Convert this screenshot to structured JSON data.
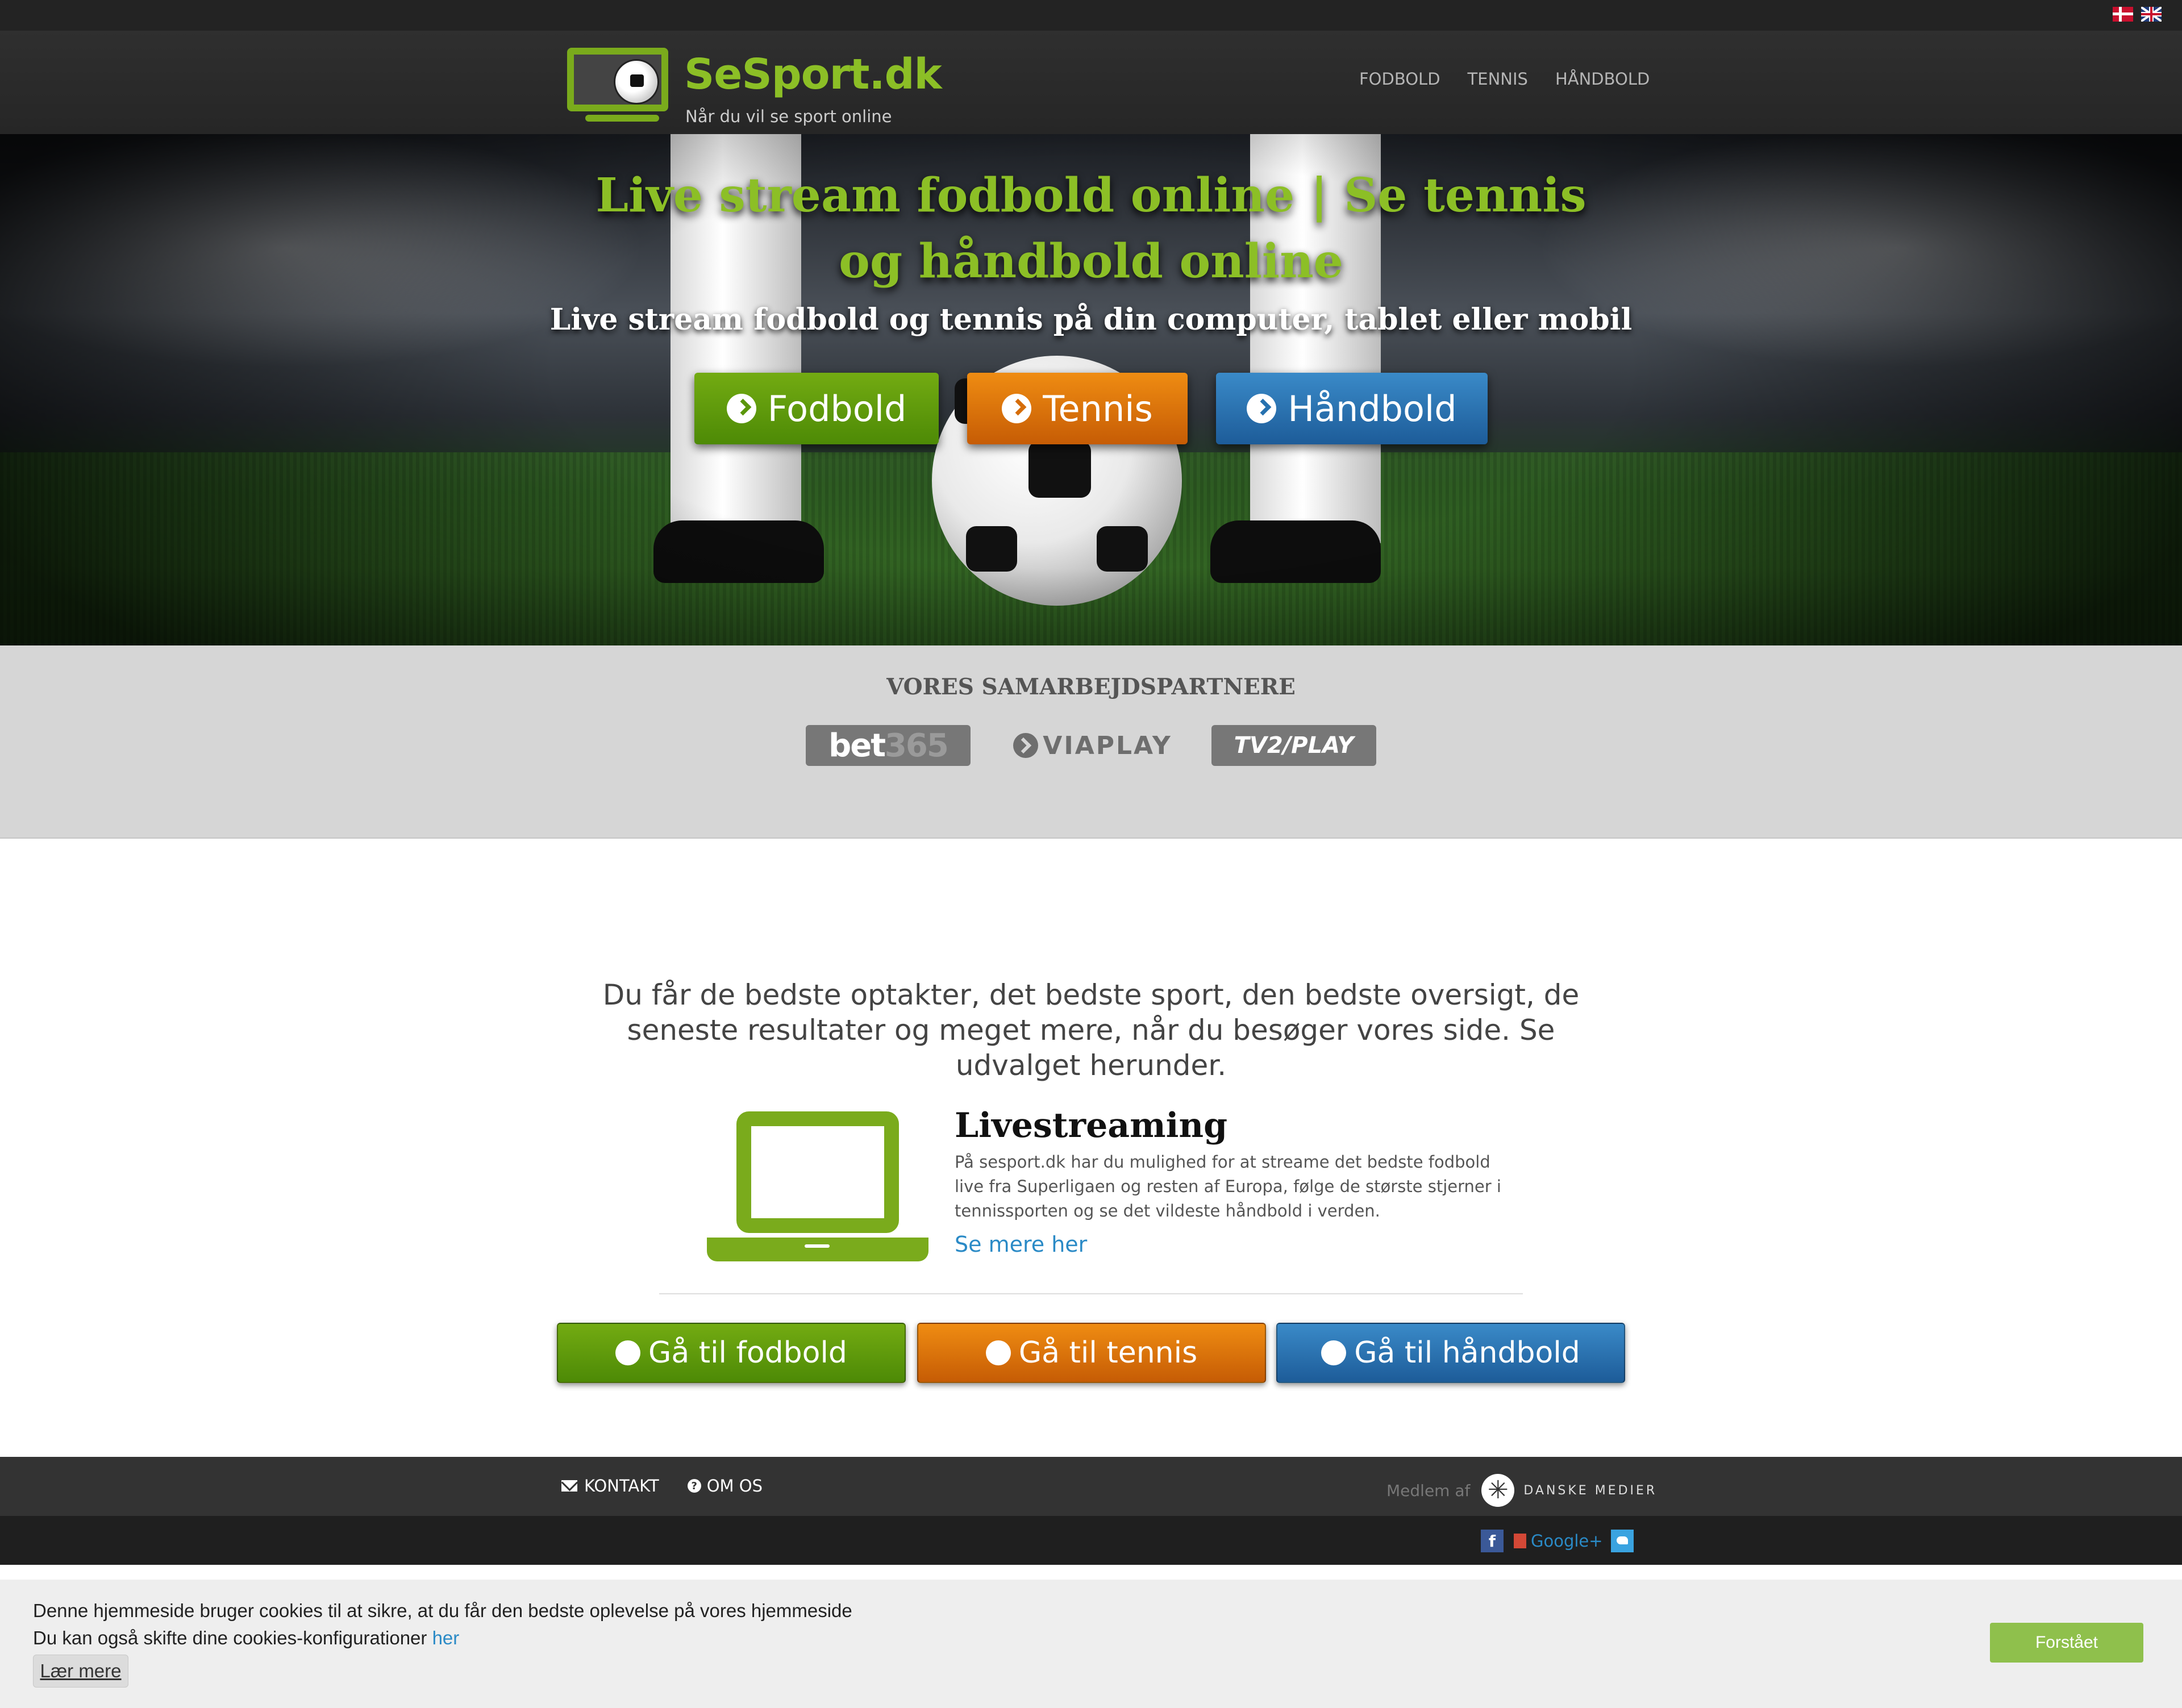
{
  "header": {
    "logo_se": "Se",
    "logo_rest": "Sport.dk",
    "tagline": "Når du vil se sport online",
    "nav": [
      "FODBOLD",
      "TENNIS",
      "HÅNDBOLD"
    ]
  },
  "hero": {
    "title": "Live stream fodbold online | Se tennis og håndbold online",
    "subtitle": "Live stream fodbold og tennis på din computer, tablet eller mobil",
    "buttons": [
      "Fodbold",
      "Tennis",
      "Håndbold"
    ]
  },
  "partners": {
    "title": "VORES SAMARBEJDSPARTNERE",
    "bet_a": "bet",
    "bet_b": "365",
    "viaplay": "VIAPLAY",
    "tv2": "TV2/PLAY"
  },
  "intro": "Du får de bedste optakter, det bedste sport, den bedste oversigt, de seneste resultater og meget mere, når du besøger vores side. Se udvalget herunder.",
  "feature": {
    "icon": "laptop-icon",
    "title": "Livestreaming",
    "body": "På sesport.dk har du mulighed for at streame det bedste fodbold live fra Superligaen og resten af Europa, følge de største stjerner i tennissporten og se det vildeste håndbold i verden.",
    "link": "Se mere her"
  },
  "goto_buttons": [
    "Gå til fodbold",
    "Gå til tennis",
    "Gå til håndbold"
  ],
  "footer": {
    "contact": "KONTAKT",
    "about": "OM OS",
    "member_label": "Medlem af",
    "member_org": "DANSKE MEDIER",
    "facebook": "f",
    "googleplus": "Google+"
  },
  "cookie": {
    "line1": "Denne hjemmeside bruger cookies til at sikre, at du får den bedste oplevelse på vores hjemmeside",
    "line2": "Du kan også skifte dine cookies-konfigurationer",
    "line2_link": "her",
    "learn_more": "Lær mere",
    "accept": "Forstået"
  },
  "colors": {
    "brand_green": "#8cbf26",
    "button_green": "#5a960a",
    "button_orange": "#d66d08",
    "button_blue": "#2671af",
    "link_blue": "#2a8ac6"
  }
}
